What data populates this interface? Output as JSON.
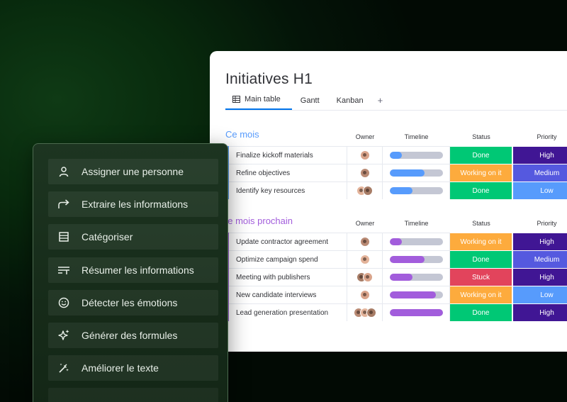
{
  "board": {
    "title": "Initiatives H1",
    "tabs": [
      {
        "label": "Main table",
        "icon": "table-icon",
        "active": true
      },
      {
        "label": "Gantt"
      },
      {
        "label": "Kanban"
      }
    ],
    "add_tab": "+",
    "columns": {
      "owner": "Owner",
      "timeline": "Timeline",
      "status": "Status",
      "priority": "Priority"
    },
    "groups": [
      {
        "title": "Ce mois",
        "color": "#579bfc",
        "rows": [
          {
            "name": "Finalize kickoff materials",
            "owners": 1,
            "timeline": 0.22,
            "status": "Done",
            "priority": "High"
          },
          {
            "name": "Refine objectives",
            "owners": 1,
            "timeline": 0.65,
            "status": "Working on it",
            "priority": "Medium"
          },
          {
            "name": "Identify key resources",
            "owners": 2,
            "timeline": 0.42,
            "status": "Done",
            "priority": "Low"
          }
        ]
      },
      {
        "title": "Le mois prochain",
        "color": "#a25ddc",
        "rows": [
          {
            "name": "Update contractor agreement",
            "owners": 1,
            "timeline": 0.22,
            "status": "Working on it",
            "priority": "High"
          },
          {
            "name": "Optimize campaign spend",
            "owners": 1,
            "timeline": 0.65,
            "status": "Done",
            "priority": "Medium"
          },
          {
            "name": "Meeting with publishers",
            "owners": 2,
            "timeline": 0.43,
            "status": "Stuck",
            "priority": "High"
          },
          {
            "name": "New candidate interviews",
            "owners": 1,
            "timeline": 0.87,
            "status": "Working on it",
            "priority": "Low"
          },
          {
            "name": "Lead generation presentation",
            "owners": 3,
            "timeline": 1.0,
            "status": "Done",
            "priority": "High"
          }
        ]
      }
    ],
    "status_colors": {
      "Done": "#00c875",
      "Working on it": "#fdab3d",
      "Stuck": "#e2445c"
    },
    "priority_colors": {
      "High": "#401694",
      "Medium": "#5559df",
      "Low": "#579bfc"
    }
  },
  "ai_menu": {
    "items": [
      {
        "label": "Assigner une personne",
        "icon": "person-icon"
      },
      {
        "label": "Extraire les informations",
        "icon": "forward-arrow-icon"
      },
      {
        "label": "Catégoriser",
        "icon": "list-box-icon"
      },
      {
        "label": "Résumer les informations",
        "icon": "text-format-icon"
      },
      {
        "label": "Détecter les émotions",
        "icon": "smiley-icon"
      },
      {
        "label": "Générer des formules",
        "icon": "sparkle-icon"
      },
      {
        "label": "Améliorer le texte",
        "icon": "magic-pen-icon"
      }
    ]
  }
}
